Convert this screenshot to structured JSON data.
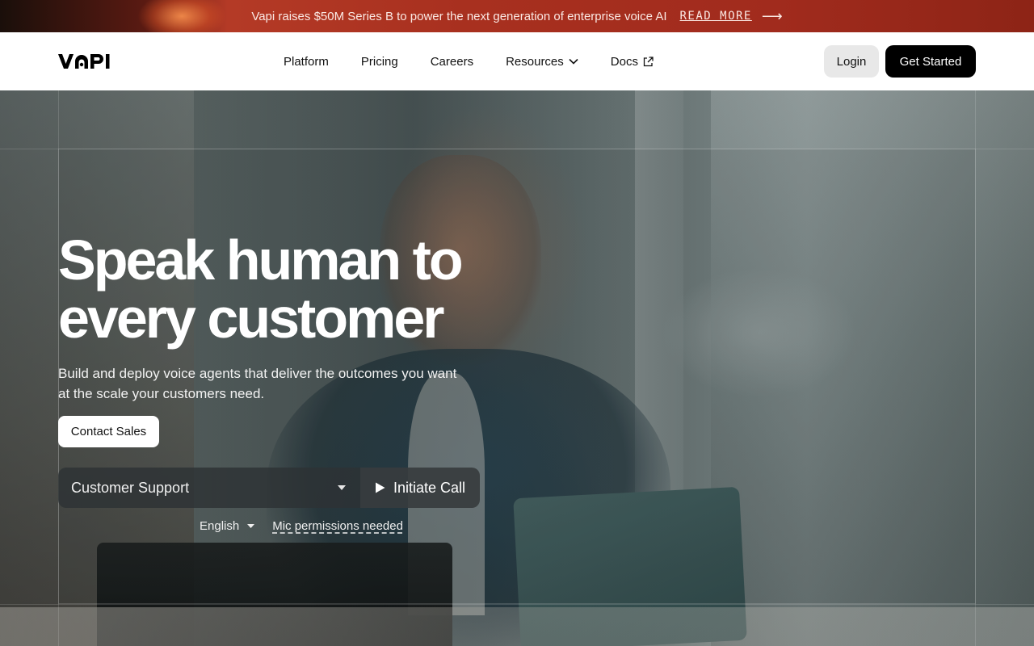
{
  "announcement": {
    "message": "Vapi raises $50M Series B to power the next generation of enterprise voice AI",
    "link_label": "READ MORE",
    "arrow_icon": "arrow-right-icon"
  },
  "nav": {
    "logo_text": "VAPI",
    "links": [
      {
        "label": "Platform"
      },
      {
        "label": "Pricing"
      },
      {
        "label": "Careers"
      },
      {
        "label": "Resources",
        "icon": "chevron-down-icon"
      },
      {
        "label": "Docs",
        "icon": "external-link-icon"
      }
    ],
    "login_label": "Login",
    "get_started_label": "Get Started"
  },
  "hero": {
    "headline_line1": "Speak human to",
    "headline_line2": "every customer",
    "subtitle": "Build and deploy voice agents that deliver the outcomes you want at the scale your customers need.",
    "contact_label": "Contact Sales",
    "scenario_selected": "Customer Support",
    "call_label": "Initiate Call",
    "language_selected": "English",
    "mic_notice": "Mic permissions needed"
  },
  "colors": {
    "announcement_bg": "#a8301f",
    "primary_button": "#000000",
    "secondary_button": "#e8e8e8"
  }
}
